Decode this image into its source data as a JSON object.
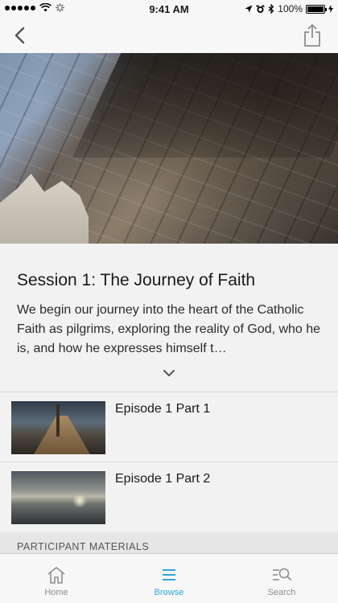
{
  "status": {
    "time": "9:41 AM",
    "battery": "100%"
  },
  "nav": {
    "back_icon": "chevron-left-icon",
    "share_icon": "share-icon"
  },
  "session": {
    "title": "Session 1: The Journey of Faith",
    "description": "We begin our journey into the heart of the Catholic Faith as pilgrims, exploring the reality of God, who he is, and how he expresses himself t…"
  },
  "episodes": [
    {
      "title": "Episode 1 Part 1"
    },
    {
      "title": "Episode 1 Part 2"
    }
  ],
  "section": {
    "header": "PARTICIPANT MATERIALS"
  },
  "tabs": [
    {
      "label": "Home",
      "icon": "home-icon",
      "active": false
    },
    {
      "label": "Browse",
      "icon": "menu-icon",
      "active": true
    },
    {
      "label": "Search",
      "icon": "search-icon",
      "active": false
    }
  ],
  "colors": {
    "accent": "#2fa7d8",
    "inactive": "#8e8e8e"
  }
}
